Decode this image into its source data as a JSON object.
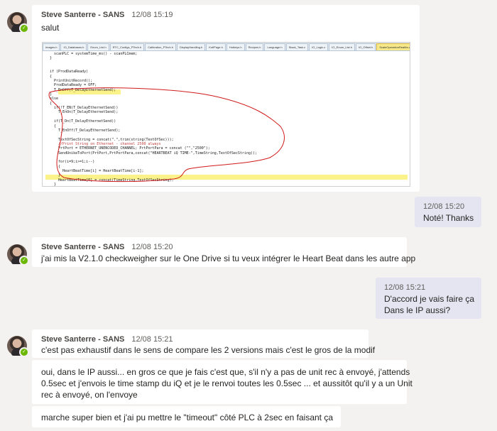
{
  "messages": {
    "m1": {
      "author": "Steve Santerre - SANS",
      "time": "12/08 15:19",
      "text": "salut"
    },
    "m2": {
      "time": "12/08 15:20",
      "text": "Noté! Thanks"
    },
    "m3": {
      "author": "Steve Santerre - SANS",
      "time": "12/08 15:20",
      "text": "j'ai mis la V2.1.0 checkweigher sur le One Drive si tu veux intégrer le Heart Beat dans les autre app"
    },
    "m4": {
      "time": "12/08 15:21",
      "line1": "D'accord je vais faire ça",
      "line2": "Dans le IP aussi?"
    },
    "m5": {
      "author": "Steve Santerre - SANS",
      "time": "12/08 15:21",
      "text": "c'est pas exhaustif dans le sens de compare les 2 versions mais c'est le gros de la modif",
      "followup1_line1": "oui, dans le IP aussi... en gros ce que je fais c'est que, s'il n'y a pas de unit rec à envoyé, j'attends",
      "followup1_line2": "0.5sec et j'envois le time stamp du iQ et je le renvoi toutes les 0.5sec ... et aussitôt qu'il y a un Unit",
      "followup1_line3": "rec à envoyé, on l'envoye",
      "followup2": "marche super bien et j'ai pu mettre le \"timeout\" côté PLC à 2sec en faisant ça"
    }
  },
  "code_screenshot": {
    "tabs": [
      "Images.h",
      "IO_Databases.h",
      "Enum_List.h",
      "RTC_Configs_PTech.h",
      "Calibration_PTech.h",
      "DisplayHandling.h",
      "KofiPage.h",
      "Hotkeys.h",
      "Recipes.h",
      "Language.h",
      "Stack_Task.c",
      "IO_Logic.c",
      "IO_Enum_List.h",
      "IO_Offset.h",
      "ScaleOperationRealIfa.c"
    ],
    "lines": [
      "  scanPLC = systemTime_ms() - scanPLCmem;",
      "}",
      "",
      "",
      "if (ProdDataReady)",
      "{",
      "  PrintUnitRecord();",
      "  ProdDataReady = OFF;",
      "  T_EnOff(T_DelayEthernetSend);",
      "}",
      "else",
      "{",
      "  if(!T_EN(T_DelayEthernetSend))",
      "    T_EnOn(T_DelayEthernetSend);",
      "",
      "  if(T_Dn(T_DelayEthernetSend))",
      "  {",
      "    T_EnOff(T_DelayEthernetSend);",
      "",
      "    TextOfSecString = concat(\".\",trim(string(TextOfSec)));",
      "    //Print String on Ethernet - channel 2500 always",
      "    PrtPort = ETHERNET_UNENCODED_CHANNEL; PrtPortPara = concat (\"\",\"2500\");",
      "    SendUnikeToPort(PrtPort,PrtPortPara,concat(\"HEARTBEAT iQ TIME-\",TimeString,TextOfSecString));",
      "",
      "    for(i=9;i>=1;i--)",
      "    {",
      "      HeartBeatTime[i] = HeartBeatTime[i-1];",
      "    }",
      "    HeartBeatTime[0] = concat(TimeString,TextOfSecString);",
      "  }",
      "}"
    ]
  }
}
